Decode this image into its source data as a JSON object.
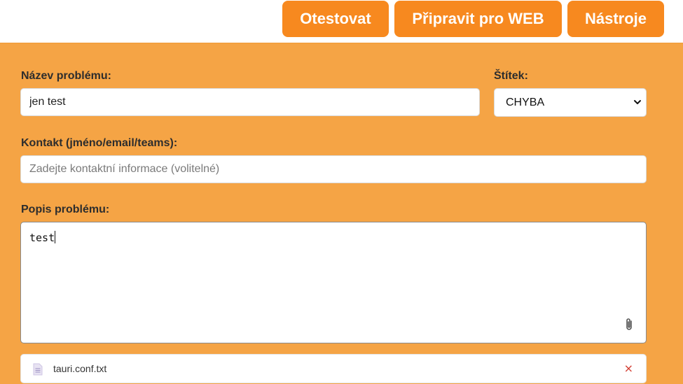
{
  "toolbar": {
    "test_label": "Otestovat",
    "web_label": "Připravit pro WEB",
    "tools_label": "Nástroje"
  },
  "form": {
    "name_label": "Název problému:",
    "name_value": "jen test",
    "tag_label": "Štítek:",
    "tag_value": "CHYBA",
    "contact_label": "Kontakt (jméno/email/teams):",
    "contact_placeholder": "Zadejte kontaktní informace (volitelné)",
    "contact_value": "",
    "description_label": "Popis problému:",
    "description_value": "test"
  },
  "attachments": [
    {
      "name": "tauri.conf.txt",
      "remove_label": "×"
    }
  ],
  "colors": {
    "accent": "#f7891f",
    "panel": "#f5a445",
    "remove": "#d23b2f"
  },
  "icons": {
    "attach": "paperclip-icon",
    "file": "file-text-icon",
    "select": "chevron-down-icon"
  }
}
